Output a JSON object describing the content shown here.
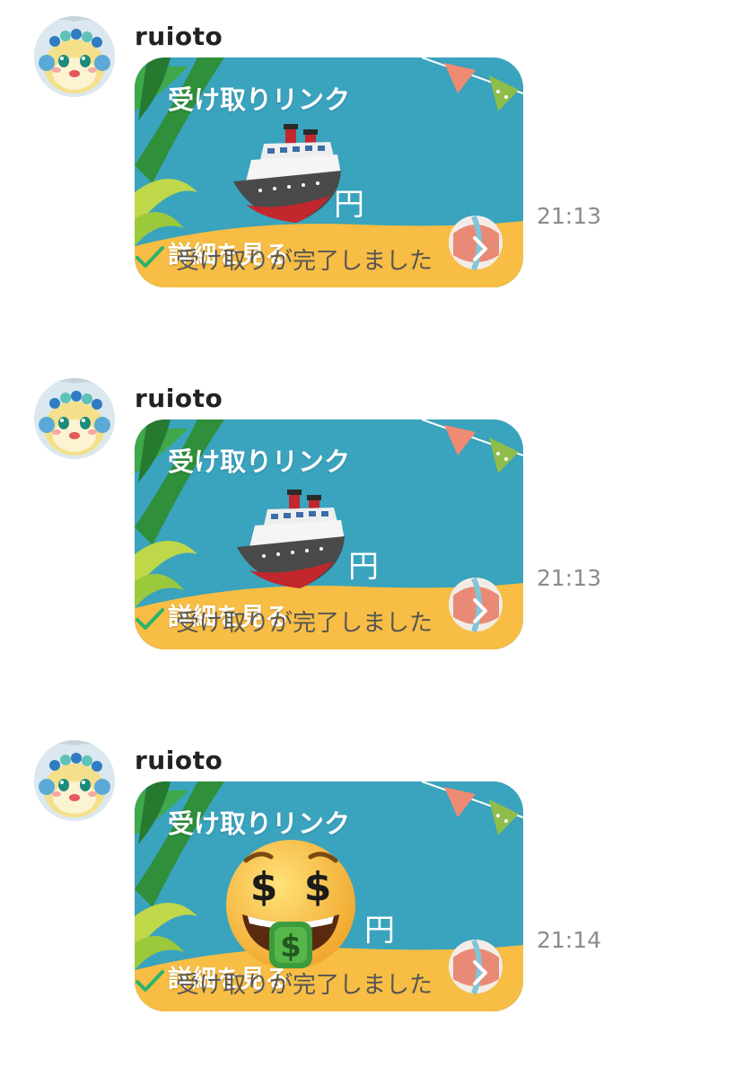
{
  "messages": [
    {
      "sender": "ruioto",
      "card_title": "受け取りリンク",
      "amount_unit": "円",
      "detail_label": "詳細を見る",
      "time": "21:13",
      "status": "受け取りが完了しました",
      "emoji": "ship-icon"
    },
    {
      "sender": "ruioto",
      "card_title": "受け取りリンク",
      "amount_unit": "円",
      "detail_label": "詳細を見る",
      "time": "21:13",
      "status": "受け取りが完了しました",
      "emoji": "ship-icon"
    },
    {
      "sender": "ruioto",
      "card_title": "受け取りリンク",
      "amount_unit": "円",
      "detail_label": "詳細を見る",
      "time": "21:14",
      "status": "受け取りが完了しました",
      "emoji": "money-mouth-face-icon"
    }
  ],
  "colors": {
    "card_sky": "#3aa3bd",
    "card_sand": "#f7bd44",
    "check": "#2cb36b",
    "timestamp": "#8c8c8c"
  }
}
